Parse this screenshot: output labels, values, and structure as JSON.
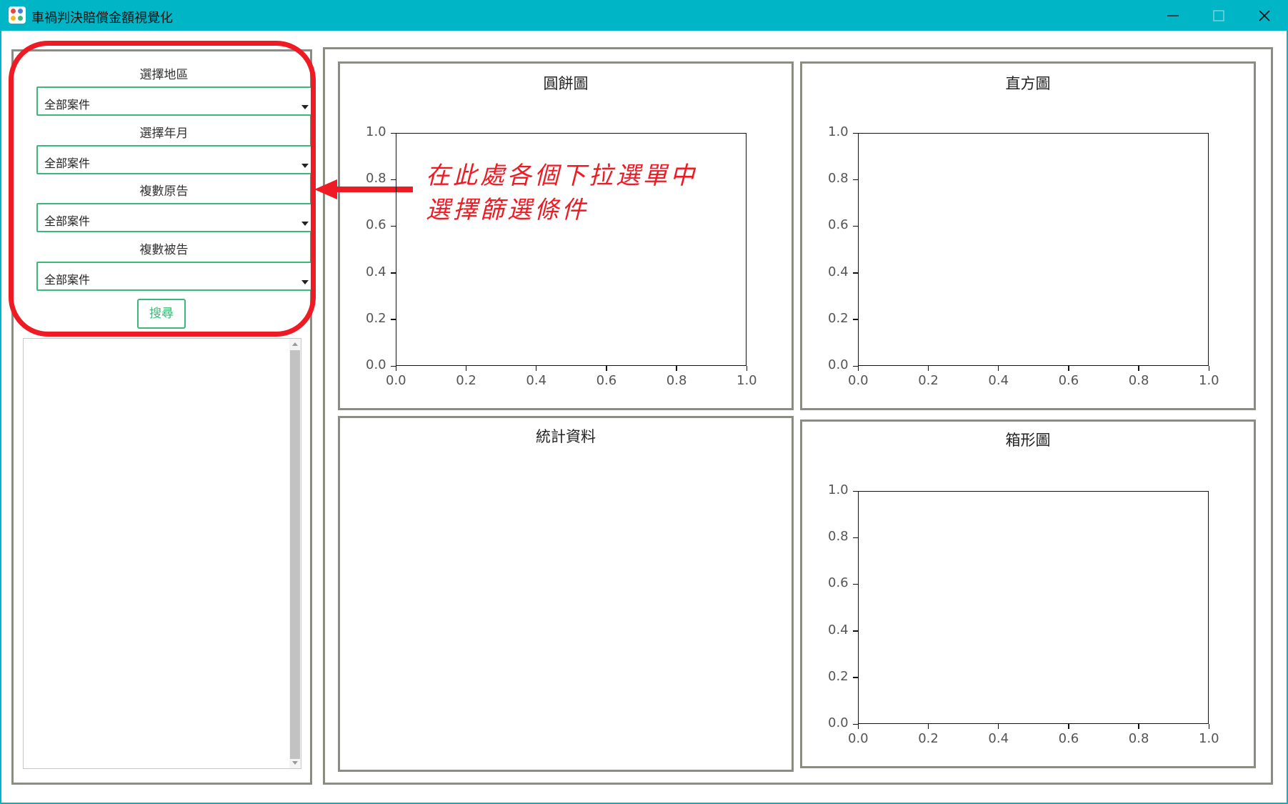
{
  "window": {
    "title": "車禍判決賠償金額視覺化"
  },
  "filters": [
    {
      "label": "選擇地區",
      "value": "全部案件"
    },
    {
      "label": "選擇年月",
      "value": "全部案件"
    },
    {
      "label": "複數原告",
      "value": "全部案件"
    },
    {
      "label": "複數被告",
      "value": "全部案件"
    }
  ],
  "search_button": "搜尋",
  "panels": {
    "pie": {
      "title": "圓餅圖"
    },
    "histogram": {
      "title": "直方圖"
    },
    "stats": {
      "title": "統計資料"
    },
    "boxplot": {
      "title": "箱形圖"
    }
  },
  "annotation": {
    "line1": "在此處各個下拉選單中",
    "line2": "選擇篩選條件"
  },
  "colors": {
    "titlebar": "#00b5c6",
    "select_border": "#3cb878",
    "highlight": "#ee1b24",
    "panel_border": "#8c8c82"
  },
  "chart_data": [
    {
      "type": "scatter",
      "title": "圓餅圖",
      "xlim": [
        0.0,
        1.0
      ],
      "ylim": [
        0.0,
        1.0
      ],
      "x_ticks": [
        "0.0",
        "0.2",
        "0.4",
        "0.6",
        "0.8",
        "1.0"
      ],
      "y_ticks": [
        "0.0",
        "0.2",
        "0.4",
        "0.6",
        "0.8",
        "1.0"
      ],
      "series": []
    },
    {
      "type": "scatter",
      "title": "直方圖",
      "xlim": [
        0.0,
        1.0
      ],
      "ylim": [
        0.0,
        1.0
      ],
      "x_ticks": [
        "0.0",
        "0.2",
        "0.4",
        "0.6",
        "0.8",
        "1.0"
      ],
      "y_ticks": [
        "0.0",
        "0.2",
        "0.4",
        "0.6",
        "0.8",
        "1.0"
      ],
      "series": []
    },
    {
      "type": "scatter",
      "title": "箱形圖",
      "xlim": [
        0.0,
        1.0
      ],
      "ylim": [
        0.0,
        1.0
      ],
      "x_ticks": [
        "0.0",
        "0.2",
        "0.4",
        "0.6",
        "0.8",
        "1.0"
      ],
      "y_ticks": [
        "0.0",
        "0.2",
        "0.4",
        "0.6",
        "0.8",
        "1.0"
      ],
      "series": []
    }
  ]
}
